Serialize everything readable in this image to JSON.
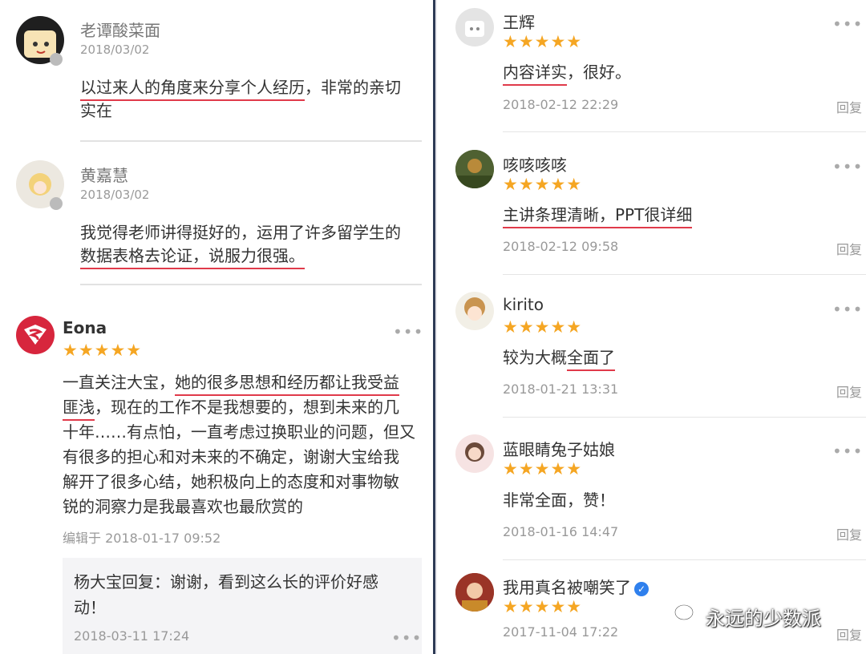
{
  "left": {
    "c1": {
      "name": "老谭酸菜面",
      "date": "2018/03/02",
      "lines": [
        [
          "以过来人的角度来分享个人经历",
          "，非常的亲切"
        ],
        [
          "实在",
          ""
        ]
      ]
    },
    "c2": {
      "name": "黄嘉慧",
      "date": "2018/03/02",
      "lines": [
        [
          "我觉得老师讲得挺好的，运用了许多留学生的",
          ""
        ],
        [
          "数据表格去论证，说服力很强。",
          ""
        ]
      ]
    },
    "c3": {
      "name": "Eona",
      "stars": "★★★★★",
      "more": "•••",
      "lines": [
        "一直关注大宝，",
        "她的很多思想和经历都让我受益",
        "匪浅",
        "，现在的工作不是我想要的，想到未来的几",
        "十年……有点怕，一直考虑过换职业的问题，但又",
        "有很多的担心和对未来的不确定，谢谢大宝给我",
        "解开了很多心结，她积极向上的态度和对事物敏",
        "锐的洞察力是我最喜欢也最欣赏的"
      ],
      "edited": "编辑于 2018-01-17 09:52",
      "reply": {
        "line1": "杨大宝回复：谢谢，看到这么长的评价好感",
        "line2": "动！",
        "date": "2018-03-11 17:24",
        "more": "•••"
      }
    }
  },
  "right": {
    "reply_label": "回复",
    "items": [
      {
        "name": "王辉",
        "stars": "★★★★★",
        "text_ul": "内容详实",
        "text_rest": "，很好。",
        "date": "2018-02-12 22:29",
        "more": "•••"
      },
      {
        "name": "咳咳咳咳",
        "stars": "★★★★★",
        "text_ul": "主讲条理清晰，PPT很详细",
        "text_rest": "",
        "date": "2018-02-12 09:58",
        "more": "•••"
      },
      {
        "name": "kirito",
        "stars": "★★★★★",
        "text_pre": "较为大概",
        "text_ul": "全面了",
        "date": "2018-01-21 13:31",
        "more": "•••"
      },
      {
        "name": "蓝眼睛兔子姑娘",
        "stars": "★★★★★",
        "text": "非常全面，赞！",
        "date": "2018-01-16 14:47",
        "more": "•••"
      },
      {
        "name": "我用真名被嘲笑了",
        "verified": "✓",
        "stars": "★★★★★",
        "date": "2017-11-04 17:22"
      }
    ]
  },
  "watermark": "永远的少数派",
  "colors": {
    "star": "#f5a623",
    "underline": "#e03a4a",
    "verified": "#2f80ed",
    "divider": "#2d3a55"
  }
}
